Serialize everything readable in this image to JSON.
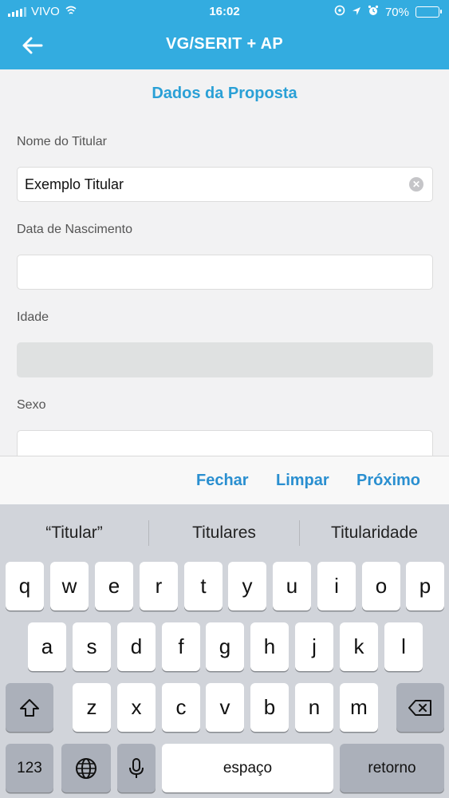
{
  "status_bar": {
    "carrier": "VIVO",
    "time": "16:02",
    "battery": "70%",
    "battery_level": 0.7
  },
  "header": {
    "title": "VG/SERIT + AP"
  },
  "form": {
    "section_title": "Dados da Proposta",
    "fields": [
      {
        "label": "Nome do Titular",
        "value": "Exemplo Titular"
      },
      {
        "label": "Data de Nascimento",
        "value": ""
      },
      {
        "label": "Idade",
        "value": ""
      },
      {
        "label": "Sexo",
        "value": ""
      }
    ]
  },
  "accessory_bar": {
    "close": "Fechar",
    "clear": "Limpar",
    "next": "Próximo"
  },
  "keyboard": {
    "suggestions": [
      "“Titular”",
      "Titulares",
      "Titularidade"
    ],
    "rows": [
      [
        "q",
        "w",
        "e",
        "r",
        "t",
        "y",
        "u",
        "i",
        "o",
        "p"
      ],
      [
        "a",
        "s",
        "d",
        "f",
        "g",
        "h",
        "j",
        "k",
        "l"
      ],
      [
        "z",
        "x",
        "c",
        "v",
        "b",
        "n",
        "m"
      ]
    ],
    "numbers_key": "123",
    "space_key": "espaço",
    "return_key": "retorno"
  }
}
